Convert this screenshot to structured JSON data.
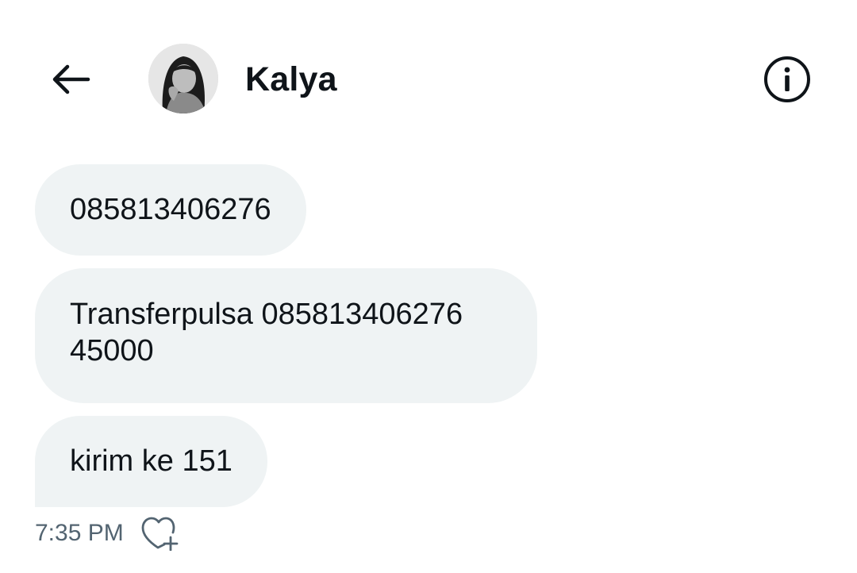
{
  "header": {
    "back_icon": "arrow-left-icon",
    "contact_name": "Kalya",
    "info_icon": "info-circle-icon"
  },
  "messages": [
    {
      "text": "085813406276"
    },
    {
      "text": "Transferpulsa 085813406276\n45000"
    },
    {
      "text": "kirim ke 151"
    }
  ],
  "meta": {
    "timestamp": "7:35 PM",
    "like_icon": "heart-plus-icon"
  },
  "colors": {
    "bubble_background": "#eff3f4",
    "text_primary": "#0f1419",
    "text_secondary": "#536471"
  }
}
